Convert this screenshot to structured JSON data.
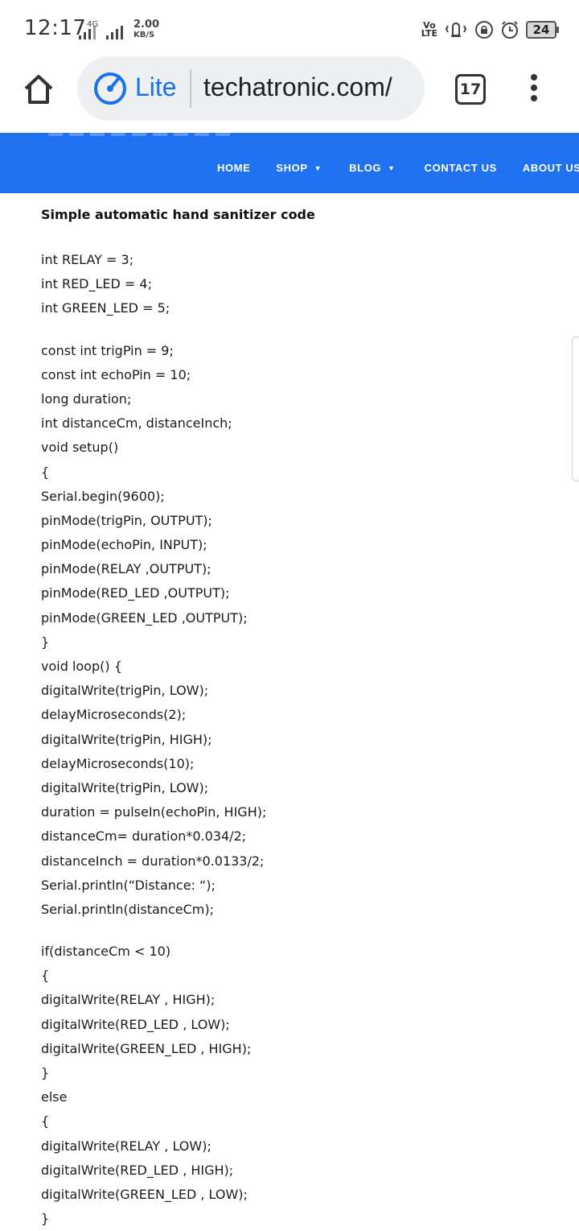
{
  "status_bar": {
    "time": "12:17",
    "network_type": "4G",
    "speed_value": "2.00",
    "speed_unit": "KB/S",
    "volte_top": "Vo",
    "volte_bottom": "LTE",
    "battery": "24"
  },
  "browser": {
    "lite_label": "Lite",
    "url": "techatronic.com/",
    "tab_count": "17"
  },
  "site_nav": {
    "items": [
      {
        "label": "HOME"
      },
      {
        "label": "SHOP"
      },
      {
        "label": "BLOG"
      },
      {
        "label": "CONTACT US"
      },
      {
        "label": "ABOUT US"
      }
    ]
  },
  "article": {
    "title": "Simple automatic hand sanitizer code",
    "code_block_1": [
      "int RELAY = 3;",
      "int RED_LED = 4;",
      "int GREEN_LED = 5;"
    ],
    "code_block_2": [
      "const int trigPin = 9;",
      "const int echoPin = 10;",
      "long duration;",
      "int distanceCm, distanceInch;",
      "void setup()",
      "{",
      "Serial.begin(9600);",
      "pinMode(trigPin, OUTPUT);",
      "pinMode(echoPin, INPUT);",
      "pinMode(RELAY ,OUTPUT);",
      "pinMode(RED_LED ,OUTPUT);",
      "pinMode(GREEN_LED ,OUTPUT);",
      "}",
      "void loop() {",
      "digitalWrite(trigPin, LOW);",
      "delayMicroseconds(2);",
      "digitalWrite(trigPin, HIGH);",
      "delayMicroseconds(10);",
      "digitalWrite(trigPin, LOW);",
      "duration = pulseIn(echoPin, HIGH);",
      "distanceCm= duration*0.034/2;",
      "distanceInch = duration*0.0133/2;",
      "Serial.println(“Distance: “);",
      "Serial.println(distanceCm);"
    ],
    "code_block_3": [
      "if(distanceCm < 10)",
      "{",
      "digitalWrite(RELAY , HIGH);",
      "digitalWrite(RED_LED , LOW);",
      "digitalWrite(GREEN_LED , HIGH);",
      "}",
      "else",
      "{",
      "digitalWrite(RELAY , LOW);",
      "digitalWrite(RED_LED , HIGH);",
      "digitalWrite(GREEN_LED , LOW);",
      "}"
    ]
  },
  "colors": {
    "nav_bg": "#1f71f0",
    "lite_accent": "#1a73e8"
  }
}
